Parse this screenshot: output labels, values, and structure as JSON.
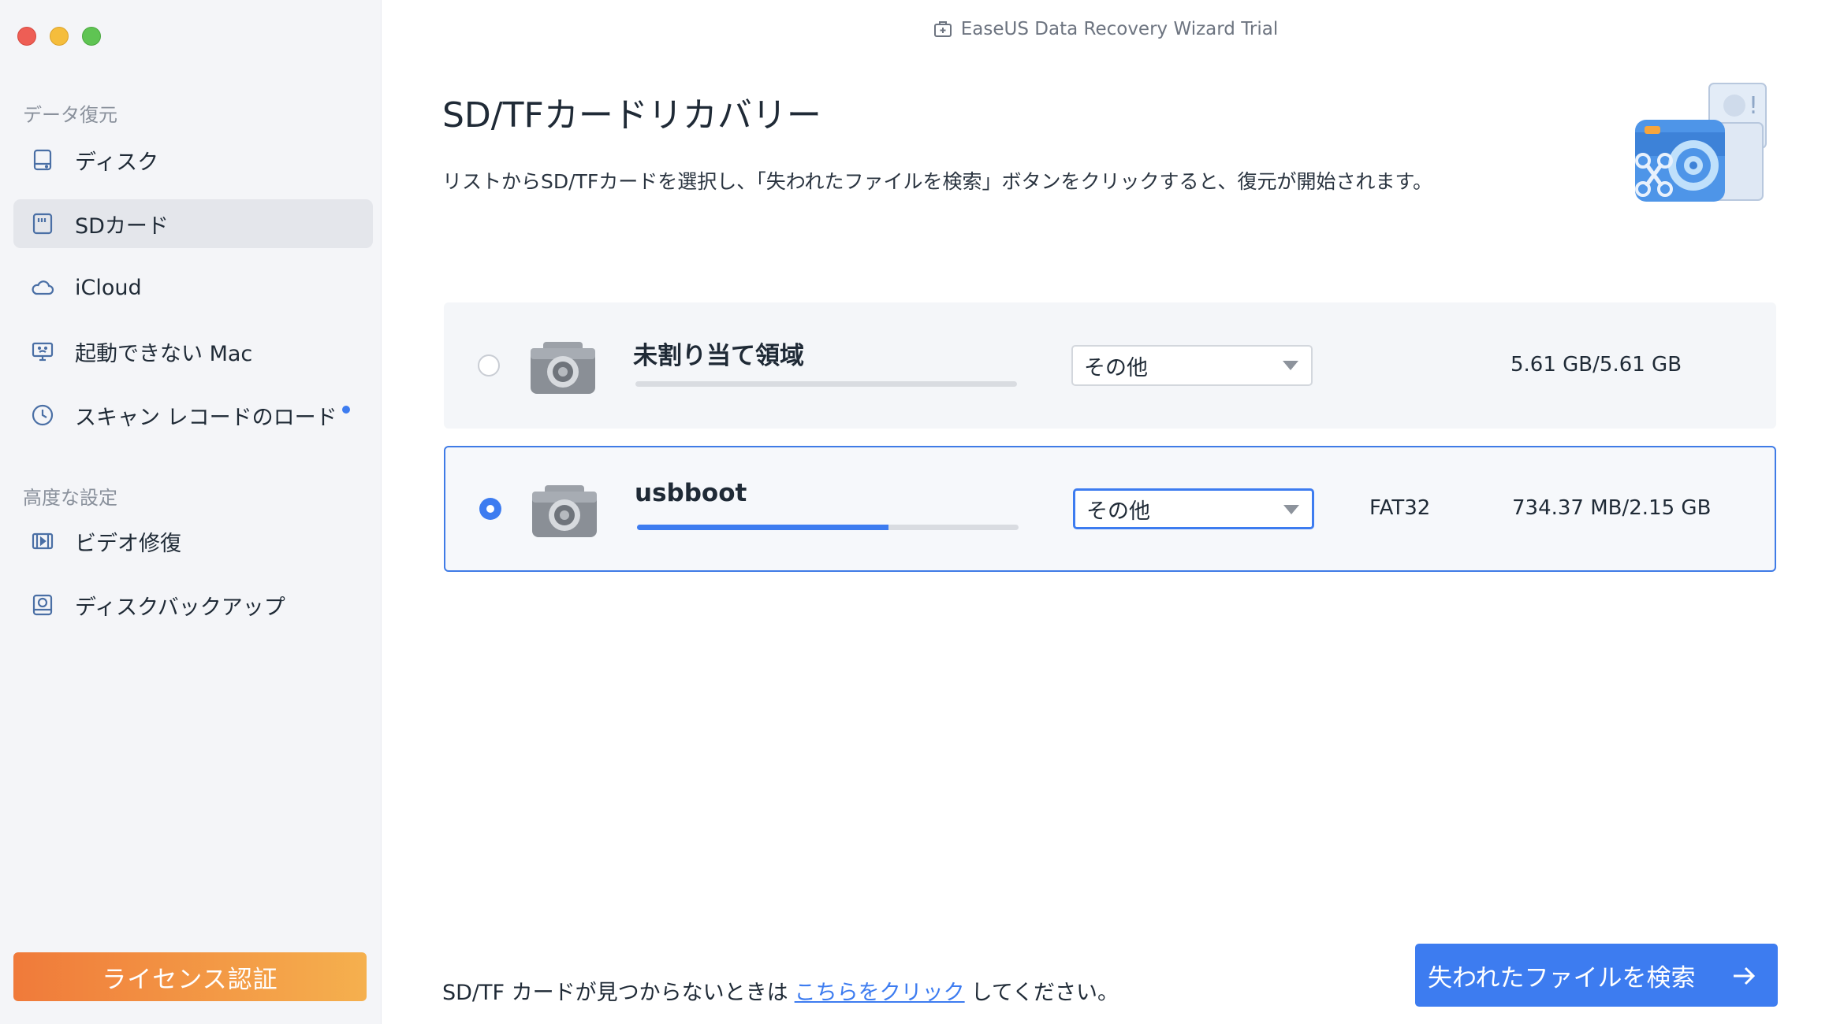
{
  "window": {
    "title": "EaseUS Data Recovery Wizard  Trial"
  },
  "sidebar": {
    "section1": "データ復元",
    "items": [
      {
        "label": "ディスク",
        "icon": "disk-icon"
      },
      {
        "label": "SDカード",
        "icon": "sd-card-icon",
        "active": true
      },
      {
        "label": "iCloud",
        "icon": "cloud-icon"
      },
      {
        "label": "起動できない Mac",
        "icon": "monitor-icon"
      },
      {
        "label": "スキャン レコードのロード",
        "icon": "clock-icon",
        "badge": true
      }
    ],
    "section2": "高度な設定",
    "items2": [
      {
        "label": "ビデオ修復",
        "icon": "film-icon"
      },
      {
        "label": "ディスクバックアップ",
        "icon": "backup-disk-icon"
      }
    ],
    "license_label": "ライセンス認証"
  },
  "main": {
    "title": "SD/TFカードリカバリー",
    "description": "リストからSD/TFカードを選択し、「失われたファイルを検索」ボタンをクリックすると、復元が開始されます。",
    "drives": [
      {
        "name": "未割り当て領域",
        "filesystem_option": "その他",
        "fs_type": "",
        "capacity": "5.61 GB/5.61 GB",
        "usage_fraction": 0.0,
        "selected": false
      },
      {
        "name": "usbboot",
        "filesystem_option": "その他",
        "fs_type": "FAT32",
        "capacity": "734.37 MB/2.15 GB",
        "usage_fraction": 0.66,
        "selected": true
      }
    ],
    "footer_prefix": "SD/TF カードが見つからないときは",
    "footer_link": "こちらをクリック",
    "footer_suffix": "してください。",
    "scan_button": "失われたファイルを検索"
  },
  "colors": {
    "accent": "#3d7cf0",
    "license_start": "#f07a3a",
    "license_end": "#f5b04e"
  }
}
